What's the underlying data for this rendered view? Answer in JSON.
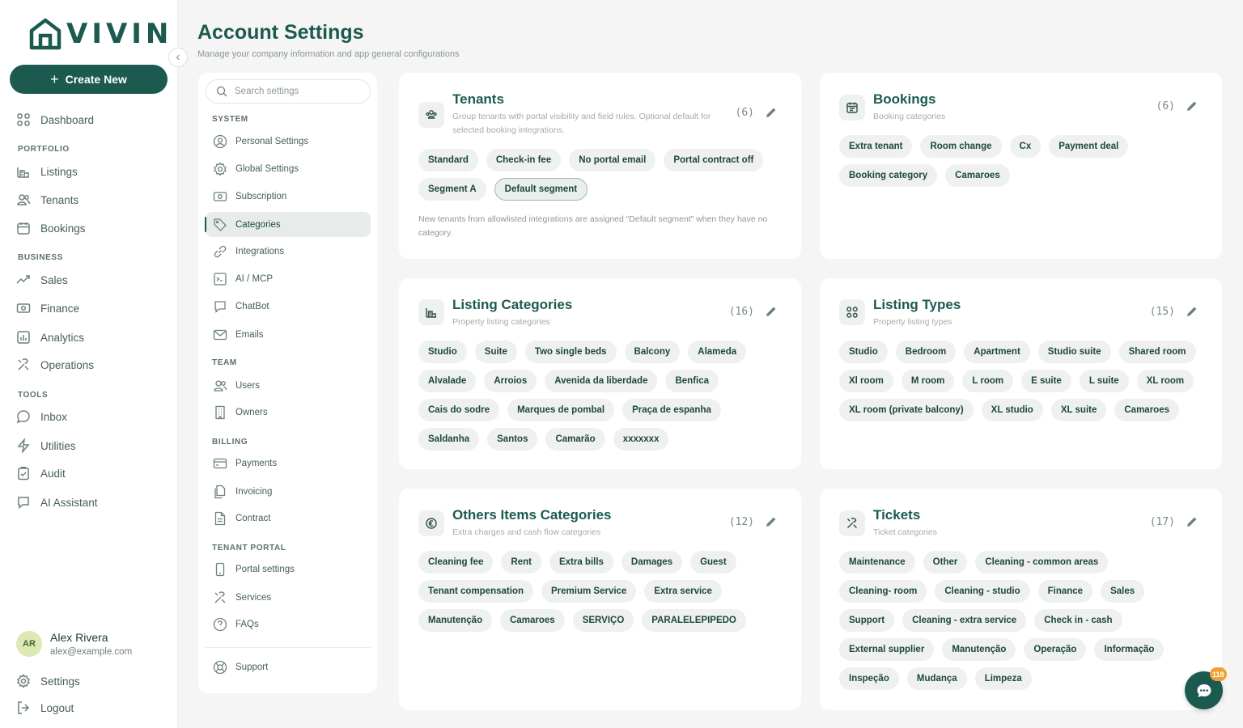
{
  "brand": {
    "logo_text": "VIVIN"
  },
  "sidebar": {
    "create_label": "Create New",
    "dashboard": "Dashboard",
    "sections": {
      "portfolio": "PORTFOLIO",
      "business": "BUSINESS",
      "tools": "TOOLS"
    },
    "portfolio": [
      "Listings",
      "Tenants",
      "Bookings"
    ],
    "business": [
      "Sales",
      "Finance",
      "Analytics",
      "Operations"
    ],
    "tools": [
      "Inbox",
      "Utilities",
      "Audit",
      "AI Assistant"
    ],
    "user": {
      "initials": "AR",
      "name": "Alex Rivera",
      "email": "alex@example.com"
    },
    "settings": "Settings",
    "logout": "Logout"
  },
  "header": {
    "title": "Account Settings",
    "subtitle": "Manage your company information and app general configurations"
  },
  "settings_menu": {
    "search_placeholder": "Search settings",
    "sections": {
      "system": "SYSTEM",
      "team": "TEAM",
      "billing": "BILLING",
      "tenant_portal": "TENANT PORTAL"
    },
    "system": [
      "Personal Settings",
      "Global Settings",
      "Subscription",
      "Categories",
      "Integrations",
      "AI / MCP",
      "ChatBot",
      "Emails"
    ],
    "team": [
      "Users",
      "Owners"
    ],
    "billing": [
      "Payments",
      "Invoicing",
      "Contract"
    ],
    "tenant_portal": [
      "Portal settings",
      "Services",
      "FAQs"
    ],
    "support": "Support",
    "active": "Categories"
  },
  "cards": {
    "tenants": {
      "title": "Tenants",
      "description": "Group tenants with portal visibility and field rules. Optional default for selected booking integrations.",
      "count": "(6)",
      "chips": [
        "Standard",
        "Check-in fee",
        "No portal email",
        "Portal contract off",
        "Segment A",
        "Default segment"
      ],
      "note": "New tenants from allowlisted integrations are assigned “Default segment” when they have no category."
    },
    "bookings": {
      "title": "Bookings",
      "description": "Booking categories",
      "count": "(6)",
      "chips": [
        "Extra tenant",
        "Room change",
        "Cx",
        "Payment deal",
        "Booking category",
        "Camaroes"
      ]
    },
    "listing_categories": {
      "title": "Listing Categories",
      "description": "Property listing categories",
      "count": "(16)",
      "chips": [
        "Studio",
        "Suite",
        "Two single beds",
        "Balcony",
        "Alameda",
        "Alvalade",
        "Arroios",
        "Avenida da liberdade",
        "Benfica",
        "Cais do sodre",
        "Marques de pombal",
        "Praça de espanha",
        "Saldanha",
        "Santos",
        "Camarão",
        "xxxxxxx"
      ]
    },
    "listing_types": {
      "title": "Listing Types",
      "description": "Property listing types",
      "count": "(15)",
      "chips": [
        "Studio",
        "Bedroom",
        "Apartment",
        "Studio suite",
        "Shared room",
        "Xl room",
        "M room",
        "L room",
        "E suite",
        "L suite",
        "XL room",
        "XL room (private balcony)",
        "XL studio",
        "XL suite",
        "Camaroes"
      ]
    },
    "others": {
      "title": "Others Items Categories",
      "description": "Extra charges and cash flow categories",
      "count": "(12)",
      "chips": [
        "Cleaning fee",
        "Rent",
        "Extra bills",
        "Damages",
        "Guest",
        "Tenant compensation",
        "Premium Service",
        "Extra service",
        "Manutenção",
        "Camaroes",
        "SERVIÇO",
        "PARALELEPIPEDO"
      ]
    },
    "tickets": {
      "title": "Tickets",
      "description": "Ticket categories",
      "count": "(17)",
      "chips": [
        "Maintenance",
        "Other",
        "Cleaning - common areas",
        "Cleaning- room",
        "Cleaning - studio",
        "Finance",
        "Sales",
        "Support",
        "Cleaning - extra service",
        "Check in - cash",
        "External supplier",
        "Manutenção",
        "Operação",
        "Informação",
        "Inspeção",
        "Mudança",
        "Limpeza"
      ]
    }
  },
  "chat": {
    "badge": "118"
  },
  "colors": {
    "brand": "#1c5a50",
    "chip_bg": "#eef1f0",
    "badge": "#f2a033"
  }
}
